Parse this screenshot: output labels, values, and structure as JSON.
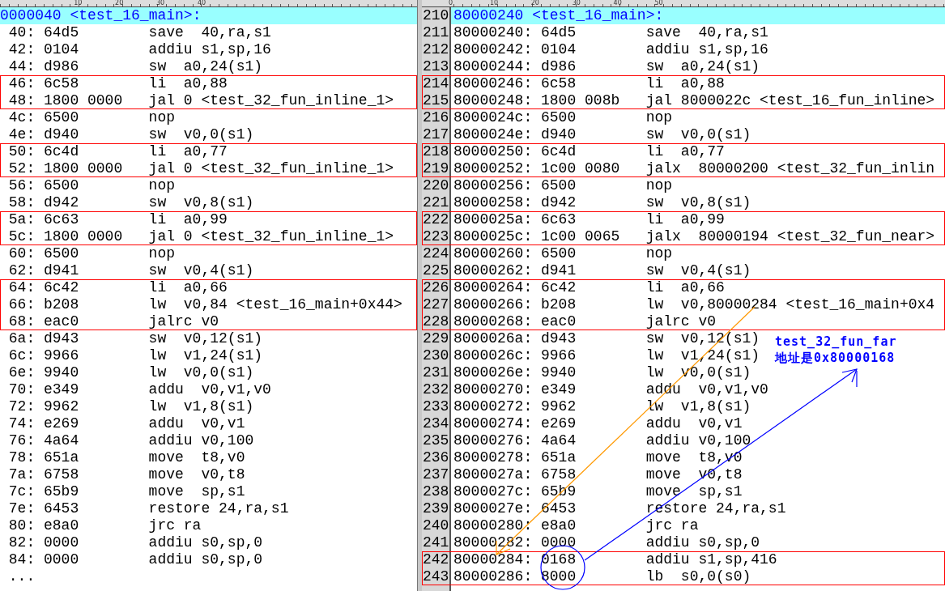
{
  "left_pane": {
    "ruler": [
      "10",
      "20",
      "30",
      "40"
    ],
    "header": "0000040 <test_16_main>:",
    "blocks": [
      {
        "boxed": false,
        "rows": [
          {
            "address": "40:",
            "hex": "64d5",
            "instruction": "save  40,ra,s1"
          },
          {
            "address": "42:",
            "hex": "0104",
            "instruction": "addiu s1,sp,16"
          },
          {
            "address": "44:",
            "hex": "d986",
            "instruction": "sw  a0,24(s1)"
          }
        ]
      },
      {
        "boxed": true,
        "rows": [
          {
            "address": "46:",
            "hex": "6c58",
            "instruction": "li  a0,88"
          },
          {
            "address": "48:",
            "hex": "1800 0000",
            "instruction": "jal 0 <test_32_fun_inline_1>"
          }
        ]
      },
      {
        "boxed": false,
        "rows": [
          {
            "address": "4c:",
            "hex": "6500",
            "instruction": "nop"
          },
          {
            "address": "4e:",
            "hex": "d940",
            "instruction": "sw  v0,0(s1)"
          }
        ]
      },
      {
        "boxed": true,
        "rows": [
          {
            "address": "50:",
            "hex": "6c4d",
            "instruction": "li  a0,77"
          },
          {
            "address": "52:",
            "hex": "1800 0000",
            "instruction": "jal 0 <test_32_fun_inline_1>"
          }
        ]
      },
      {
        "boxed": false,
        "rows": [
          {
            "address": "56:",
            "hex": "6500",
            "instruction": "nop"
          },
          {
            "address": "58:",
            "hex": "d942",
            "instruction": "sw  v0,8(s1)"
          }
        ]
      },
      {
        "boxed": true,
        "rows": [
          {
            "address": "5a:",
            "hex": "6c63",
            "instruction": "li  a0,99"
          },
          {
            "address": "5c:",
            "hex": "1800 0000",
            "instruction": "jal 0 <test_32_fun_inline_1>"
          }
        ]
      },
      {
        "boxed": false,
        "rows": [
          {
            "address": "60:",
            "hex": "6500",
            "instruction": "nop"
          },
          {
            "address": "62:",
            "hex": "d941",
            "instruction": "sw  v0,4(s1)"
          }
        ]
      },
      {
        "boxed": true,
        "rows": [
          {
            "address": "64:",
            "hex": "6c42",
            "instruction": "li  a0,66"
          },
          {
            "address": "66:",
            "hex": "b208",
            "instruction": "lw  v0,84 <test_16_main+0x44>"
          },
          {
            "address": "68:",
            "hex": "eac0",
            "instruction": "jalrc v0"
          }
        ]
      },
      {
        "boxed": false,
        "rows": [
          {
            "address": "6a:",
            "hex": "d943",
            "instruction": "sw  v0,12(s1)"
          },
          {
            "address": "6c:",
            "hex": "9966",
            "instruction": "lw  v1,24(s1)"
          },
          {
            "address": "6e:",
            "hex": "9940",
            "instruction": "lw  v0,0(s1)"
          },
          {
            "address": "70:",
            "hex": "e349",
            "instruction": "addu  v0,v1,v0"
          },
          {
            "address": "72:",
            "hex": "9962",
            "instruction": "lw  v1,8(s1)"
          },
          {
            "address": "74:",
            "hex": "e269",
            "instruction": "addu  v0,v1"
          },
          {
            "address": "76:",
            "hex": "4a64",
            "instruction": "addiu v0,100"
          },
          {
            "address": "78:",
            "hex": "651a",
            "instruction": "move  t8,v0"
          },
          {
            "address": "7a:",
            "hex": "6758",
            "instruction": "move  v0,t8"
          },
          {
            "address": "7c:",
            "hex": "65b9",
            "instruction": "move  sp,s1"
          },
          {
            "address": "7e:",
            "hex": "6453",
            "instruction": "restore 24,ra,s1"
          },
          {
            "address": "80:",
            "hex": "e8a0",
            "instruction": "jrc ra"
          },
          {
            "address": "82:",
            "hex": "0000",
            "instruction": "addiu s0,sp,0"
          },
          {
            "address": "84:",
            "hex": "0000",
            "instruction": "addiu s0,sp,0"
          }
        ]
      }
    ],
    "trailer": "..."
  },
  "right_pane": {
    "ruler": [
      "0",
      "10",
      "20",
      "30",
      "40",
      "50"
    ],
    "header": {
      "line": "210",
      "text": "80000240 <test_16_main>:"
    },
    "blocks": [
      {
        "boxed": false,
        "rows": [
          {
            "line": "211",
            "address": "80000240:",
            "hex": "64d5",
            "instruction": "save  40,ra,s1"
          },
          {
            "line": "212",
            "address": "80000242:",
            "hex": "0104",
            "instruction": "addiu s1,sp,16"
          },
          {
            "line": "213",
            "address": "80000244:",
            "hex": "d986",
            "instruction": "sw  a0,24(s1)"
          }
        ]
      },
      {
        "boxed": true,
        "rows": [
          {
            "line": "214",
            "address": "80000246:",
            "hex": "6c58",
            "instruction": "li  a0,88"
          },
          {
            "line": "215",
            "address": "80000248:",
            "hex": "1800 008b",
            "instruction": "jal 8000022c <test_16_fun_inline>"
          }
        ]
      },
      {
        "boxed": false,
        "rows": [
          {
            "line": "216",
            "address": "8000024c:",
            "hex": "6500",
            "instruction": "nop"
          },
          {
            "line": "217",
            "address": "8000024e:",
            "hex": "d940",
            "instruction": "sw  v0,0(s1)"
          }
        ]
      },
      {
        "boxed": true,
        "rows": [
          {
            "line": "218",
            "address": "80000250:",
            "hex": "6c4d",
            "instruction": "li  a0,77"
          },
          {
            "line": "219",
            "address": "80000252:",
            "hex": "1c00 0080",
            "instruction": "jalx  80000200 <test_32_fun_inlin"
          }
        ]
      },
      {
        "boxed": false,
        "rows": [
          {
            "line": "220",
            "address": "80000256:",
            "hex": "6500",
            "instruction": "nop"
          },
          {
            "line": "221",
            "address": "80000258:",
            "hex": "d942",
            "instruction": "sw  v0,8(s1)"
          }
        ]
      },
      {
        "boxed": true,
        "rows": [
          {
            "line": "222",
            "address": "8000025a:",
            "hex": "6c63",
            "instruction": "li  a0,99"
          },
          {
            "line": "223",
            "address": "8000025c:",
            "hex": "1c00 0065",
            "instruction": "jalx  80000194 <test_32_fun_near>"
          }
        ]
      },
      {
        "boxed": false,
        "rows": [
          {
            "line": "224",
            "address": "80000260:",
            "hex": "6500",
            "instruction": "nop"
          },
          {
            "line": "225",
            "address": "80000262:",
            "hex": "d941",
            "instruction": "sw  v0,4(s1)"
          }
        ]
      },
      {
        "boxed": true,
        "rows": [
          {
            "line": "226",
            "address": "80000264:",
            "hex": "6c42",
            "instruction": "li  a0,66"
          },
          {
            "line": "227",
            "address": "80000266:",
            "hex": "b208",
            "instruction": "lw  v0,80000284 <test_16_main+0x4"
          },
          {
            "line": "228",
            "address": "80000268:",
            "hex": "eac0",
            "instruction": "jalrc v0"
          }
        ]
      },
      {
        "boxed": false,
        "rows": [
          {
            "line": "229",
            "address": "8000026a:",
            "hex": "d943",
            "instruction": "sw  v0,12(s1)"
          },
          {
            "line": "230",
            "address": "8000026c:",
            "hex": "9966",
            "instruction": "lw  v1,24(s1)"
          },
          {
            "line": "231",
            "address": "8000026e:",
            "hex": "9940",
            "instruction": "lw  v0,0(s1)"
          },
          {
            "line": "232",
            "address": "80000270:",
            "hex": "e349",
            "instruction": "addu  v0,v1,v0"
          },
          {
            "line": "233",
            "address": "80000272:",
            "hex": "9962",
            "instruction": "lw  v1,8(s1)"
          },
          {
            "line": "234",
            "address": "80000274:",
            "hex": "e269",
            "instruction": "addu  v0,v1"
          },
          {
            "line": "235",
            "address": "80000276:",
            "hex": "4a64",
            "instruction": "addiu v0,100"
          },
          {
            "line": "236",
            "address": "80000278:",
            "hex": "651a",
            "instruction": "move  t8,v0"
          },
          {
            "line": "237",
            "address": "8000027a:",
            "hex": "6758",
            "instruction": "move  v0,t8"
          },
          {
            "line": "238",
            "address": "8000027c:",
            "hex": "65b9",
            "instruction": "move  sp,s1"
          },
          {
            "line": "239",
            "address": "8000027e:",
            "hex": "6453",
            "instruction": "restore 24,ra,s1"
          },
          {
            "line": "240",
            "address": "80000280:",
            "hex": "e8a0",
            "instruction": "jrc ra"
          },
          {
            "line": "241",
            "address": "80000282:",
            "hex": "0000",
            "instruction": "addiu s0,sp,0"
          }
        ]
      },
      {
        "boxed": true,
        "rows": [
          {
            "line": "242",
            "address": "80000284:",
            "hex": "0168",
            "instruction": "addiu s1,sp,416"
          },
          {
            "line": "243",
            "address": "80000286:",
            "hex": "8000",
            "instruction": "lb  s0,0(s0)"
          }
        ]
      }
    ]
  },
  "annotation": {
    "lines": [
      "test_32_fun_far",
      "地址是0x80000168"
    ]
  }
}
